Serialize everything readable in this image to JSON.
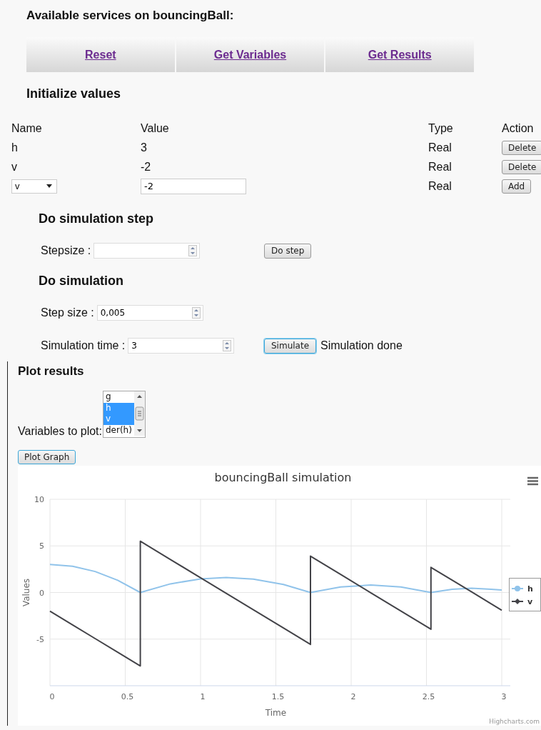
{
  "services": {
    "title": "Available services on bouncingBall:",
    "links": [
      "Reset",
      "Get Variables",
      "Get Results"
    ]
  },
  "init": {
    "title": "Initialize values",
    "columns": [
      "Name",
      "Value",
      "Type",
      "Action"
    ],
    "rows": [
      {
        "kind": "text",
        "name": "h",
        "value": "3",
        "type": "Real",
        "action": "Delete"
      },
      {
        "kind": "text",
        "name": "v",
        "value": "-2",
        "type": "Real",
        "action": "Delete"
      },
      {
        "kind": "input",
        "name": "v",
        "value": "-2",
        "type": "Real",
        "action": "Add"
      }
    ]
  },
  "step": {
    "title": "Do simulation step",
    "fields": [
      {
        "label": "Stepsize :"
      }
    ],
    "button": "Do step"
  },
  "simulation": {
    "title": "Do simulation",
    "fields": [
      {
        "label": "Step size :",
        "value": "0,005"
      },
      {
        "label": "Simulation time :",
        "value": "3"
      }
    ],
    "button": "Simulate",
    "status": "Simulation done"
  },
  "plot": {
    "title": "Plot results",
    "label": "Variables to plot:",
    "options": [
      {
        "label": "g",
        "selected": false
      },
      {
        "label": "h",
        "selected": true
      },
      {
        "label": "v",
        "selected": true
      },
      {
        "label": "der(h)",
        "selected": false
      }
    ],
    "button": "Plot Graph",
    "chart": {
      "credit": "Highcharts.com",
      "chart_data": {
        "type": "line",
        "title": "bouncingBall simulation",
        "xlabel": "Time",
        "ylabel": "Values",
        "x": [
          0,
          0.15,
          0.3,
          0.45,
          0.6,
          0.6,
          0.8,
          1.0,
          1.17,
          1.35,
          1.55,
          1.73,
          1.73,
          1.93,
          2.13,
          2.33,
          2.53,
          2.53,
          2.67,
          2.8,
          2.93,
          3
        ],
        "series": [
          {
            "name": "h",
            "color": "#90c3ea",
            "values": [
              3,
              2.81,
              2.25,
              1.31,
              0,
              0,
              0.93,
              1.46,
              1.6,
              1.43,
              0.86,
              0,
              0,
              0.6,
              0.8,
              0.6,
              0,
              0,
              0.35,
              0.45,
              0.35,
              0.26
            ]
          },
          {
            "name": "v",
            "color": "#434348",
            "values": [
              -2,
              -3.47,
              -4.94,
              -6.41,
              -7.88,
              5.5,
              3.54,
              1.58,
              -0.09,
              -1.85,
              -3.81,
              -5.57,
              3.9,
              1.94,
              -0.02,
              -1.98,
              -3.94,
              2.7,
              1.33,
              0.06,
              -1.21,
              -1.9
            ]
          }
        ],
        "xlim": [
          0,
          3
        ],
        "ylim": [
          -10,
          10
        ],
        "xticks": [
          0,
          0.5,
          1,
          1.5,
          2,
          2.5,
          3
        ],
        "yticks": [
          -5,
          0,
          5,
          10
        ],
        "grid": true,
        "legend": true
      }
    }
  }
}
